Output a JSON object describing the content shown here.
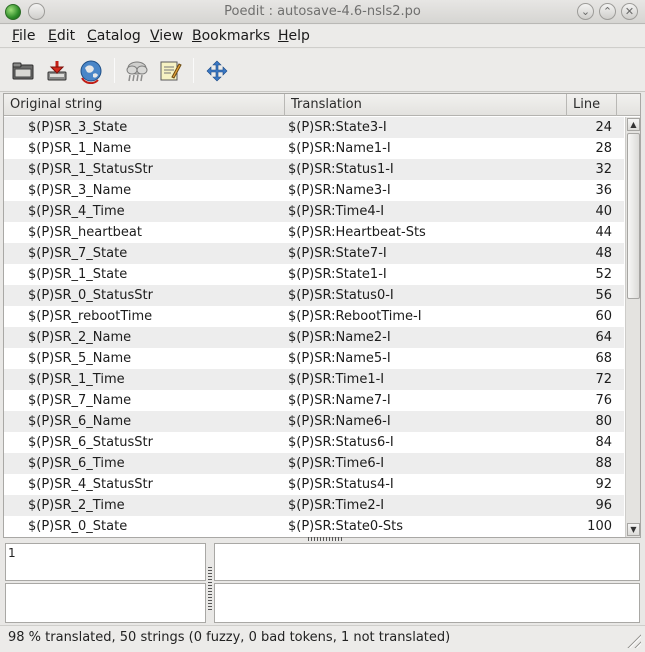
{
  "window": {
    "title": "Poedit : autosave-4.6-nsls2.po"
  },
  "menubar": {
    "items": [
      {
        "label": "File",
        "mnemonic": "F",
        "rest": "ile"
      },
      {
        "label": "Edit",
        "mnemonic": "E",
        "rest": "dit"
      },
      {
        "label": "Catalog",
        "mnemonic": "C",
        "rest": "atalog"
      },
      {
        "label": "View",
        "mnemonic": "V",
        "rest": "iew"
      },
      {
        "label": "Bookmarks",
        "mnemonic": "B",
        "rest": "ookmarks"
      },
      {
        "label": "Help",
        "mnemonic": "H",
        "rest": "elp"
      }
    ]
  },
  "toolbar": {
    "icons": [
      "open-folder-icon",
      "save-icon",
      "update-catalog-icon",
      "validate-icon",
      "comment-edit-icon",
      "fullscreen-icon"
    ]
  },
  "list": {
    "columns": {
      "original": "Original string",
      "translation": "Translation",
      "line": "Line"
    },
    "rows": [
      {
        "original": "$(P)SR_3_State",
        "translation": "$(P)SR:State3-I",
        "line": "24"
      },
      {
        "original": "$(P)SR_1_Name",
        "translation": "$(P)SR:Name1-I",
        "line": "28"
      },
      {
        "original": "$(P)SR_1_StatusStr",
        "translation": "$(P)SR:Status1-I",
        "line": "32"
      },
      {
        "original": "$(P)SR_3_Name",
        "translation": "$(P)SR:Name3-I",
        "line": "36"
      },
      {
        "original": "$(P)SR_4_Time",
        "translation": "$(P)SR:Time4-I",
        "line": "40"
      },
      {
        "original": "$(P)SR_heartbeat",
        "translation": "$(P)SR:Heartbeat-Sts",
        "line": "44"
      },
      {
        "original": "$(P)SR_7_State",
        "translation": "$(P)SR:State7-I",
        "line": "48"
      },
      {
        "original": "$(P)SR_1_State",
        "translation": "$(P)SR:State1-I",
        "line": "52"
      },
      {
        "original": "$(P)SR_0_StatusStr",
        "translation": "$(P)SR:Status0-I",
        "line": "56"
      },
      {
        "original": "$(P)SR_rebootTime",
        "translation": "$(P)SR:RebootTime-I",
        "line": "60"
      },
      {
        "original": "$(P)SR_2_Name",
        "translation": "$(P)SR:Name2-I",
        "line": "64"
      },
      {
        "original": "$(P)SR_5_Name",
        "translation": "$(P)SR:Name5-I",
        "line": "68"
      },
      {
        "original": "$(P)SR_1_Time",
        "translation": "$(P)SR:Time1-I",
        "line": "72"
      },
      {
        "original": "$(P)SR_7_Name",
        "translation": "$(P)SR:Name7-I",
        "line": "76"
      },
      {
        "original": "$(P)SR_6_Name",
        "translation": "$(P)SR:Name6-I",
        "line": "80"
      },
      {
        "original": "$(P)SR_6_StatusStr",
        "translation": "$(P)SR:Status6-I",
        "line": "84"
      },
      {
        "original": "$(P)SR_6_Time",
        "translation": "$(P)SR:Time6-I",
        "line": "88"
      },
      {
        "original": "$(P)SR_4_StatusStr",
        "translation": "$(P)SR:Status4-I",
        "line": "92"
      },
      {
        "original": "$(P)SR_2_Time",
        "translation": "$(P)SR:Time2-I",
        "line": "96"
      },
      {
        "original": "$(P)SR_0_State",
        "translation": "$(P)SR:State0-Sts",
        "line": "100"
      }
    ]
  },
  "editor": {
    "source_text": "1",
    "translation_text": "",
    "comment_text": "",
    "auto_comment_text": ""
  },
  "statusbar": {
    "text": "98 % translated, 50 strings (0 fuzzy, 0 bad tokens, 1 not translated)"
  },
  "colors": {
    "row_alt": "#ededed",
    "row": "#ffffff",
    "chrome": "#ecebe9"
  }
}
